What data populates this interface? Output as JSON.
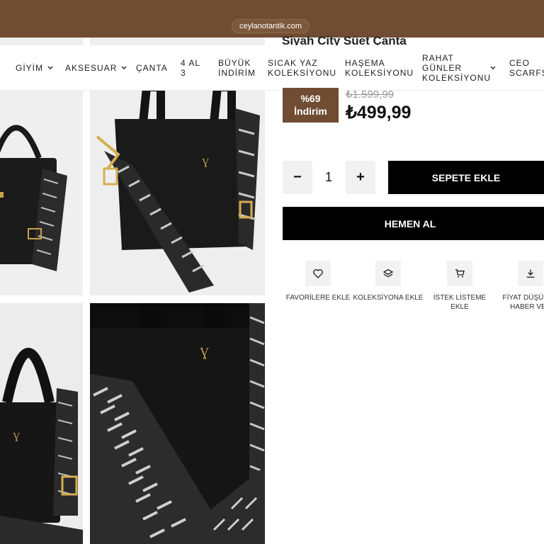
{
  "browser": {
    "url": "ceylanotantik.com"
  },
  "product": {
    "title": "Siyah City Süet Çanta",
    "discount_percent": "%69",
    "discount_label": "İndirim",
    "old_price": "₺1.599,99",
    "new_price": "₺499,99",
    "quantity": "1"
  },
  "nav": {
    "items": [
      {
        "label": "GİYİM"
      },
      {
        "label": "AKSESUAR"
      },
      {
        "label": "ÇANTA"
      },
      {
        "label": "4 AL 3"
      },
      {
        "label": "BÜYÜK İNDİRİM"
      },
      {
        "label": "SICAK YAZ KOLEKSİYONU"
      },
      {
        "label": "HAŞEMA KOLEKSİYONU"
      },
      {
        "label": "RAHAT GÜNLER KOLEKSİYONU"
      },
      {
        "label": "CEO SCARFS"
      }
    ]
  },
  "buttons": {
    "minus": "−",
    "plus": "+",
    "add_to_cart": "SEPETE EKLE",
    "buy_now": "HEMEN AL"
  },
  "actions": [
    {
      "label": "FAVORİLERE EKLE",
      "icon": "heart-icon"
    },
    {
      "label": "KOLEKSİYONA EKLE",
      "icon": "layers-icon"
    },
    {
      "label": "İSTEK LİSTEME EKLE",
      "icon": "cart-icon"
    },
    {
      "label": "FİYAT DÜŞÜNCE HABER VER",
      "icon": "download-icon"
    }
  ],
  "colors": {
    "brand": "#6f4c32",
    "button": "#000000"
  }
}
